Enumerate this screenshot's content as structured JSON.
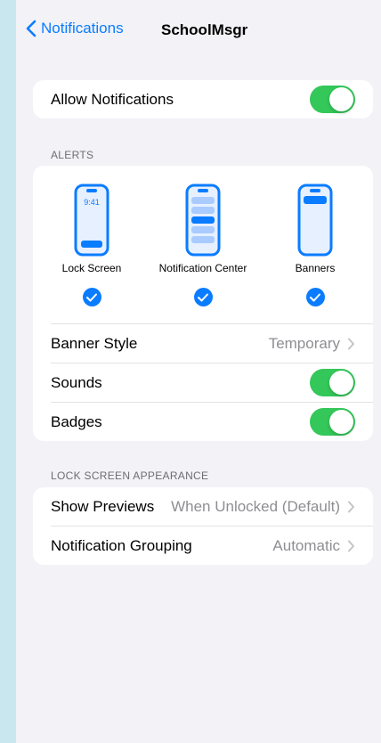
{
  "nav": {
    "back_label": "Notifications",
    "title": "SchoolMsgr"
  },
  "allow": {
    "label": "Allow Notifications",
    "on": true
  },
  "alerts": {
    "header": "ALERTS",
    "options": [
      {
        "label": "Lock Screen",
        "checked": true,
        "time": "9:41"
      },
      {
        "label": "Notification Center",
        "checked": true
      },
      {
        "label": "Banners",
        "checked": true
      }
    ],
    "banner_style": {
      "label": "Banner Style",
      "value": "Temporary"
    },
    "sounds": {
      "label": "Sounds",
      "on": true
    },
    "badges": {
      "label": "Badges",
      "on": true
    }
  },
  "lock_screen": {
    "header": "LOCK SCREEN APPEARANCE",
    "show_previews": {
      "label": "Show Previews",
      "value": "When Unlocked (Default)"
    },
    "grouping": {
      "label": "Notification Grouping",
      "value": "Automatic"
    }
  },
  "colors": {
    "accent": "#0a7cff",
    "toggle_on": "#34c759",
    "background": "#f2f2f7",
    "outer": "#c9e7ee"
  }
}
